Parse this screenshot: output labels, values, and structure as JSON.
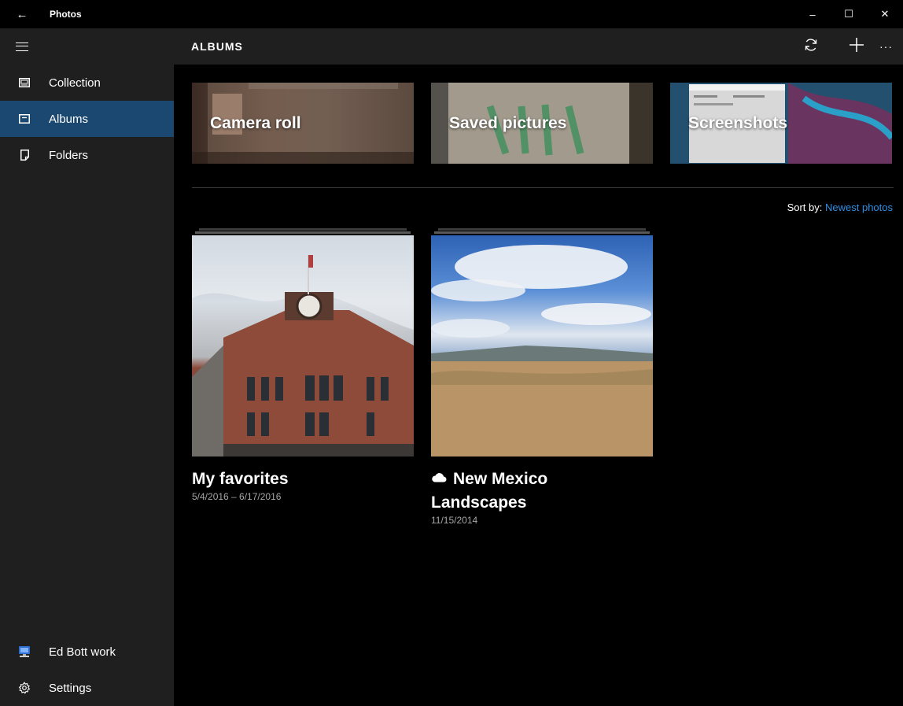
{
  "window": {
    "title": "Photos",
    "back_icon": "←",
    "minimize_icon": "–",
    "maximize_icon": "☐",
    "close_icon": "✕"
  },
  "sidebar": {
    "items": [
      {
        "label": "Collection",
        "icon": "collection-icon"
      },
      {
        "label": "Albums",
        "icon": "albums-icon",
        "active": true
      },
      {
        "label": "Folders",
        "icon": "folders-icon"
      }
    ],
    "bottom": [
      {
        "label": "Ed Bott work",
        "icon": "computer-account-icon"
      },
      {
        "label": "Settings",
        "icon": "gear-icon"
      }
    ]
  },
  "header": {
    "title": "ALBUMS",
    "more_label": "···"
  },
  "top_albums": [
    {
      "label": "Camera roll"
    },
    {
      "label": "Saved pictures"
    },
    {
      "label": "Screenshots"
    }
  ],
  "sort": {
    "prefix": "Sort by:",
    "value": "Newest photos"
  },
  "albums": [
    {
      "title": "My favorites",
      "date": "5/4/2016 – 6/17/2016"
    },
    {
      "title_line1": "New Mexico",
      "title_line2": "Landscapes",
      "date": "11/15/2014",
      "icon": "onedrive-cloud-icon"
    }
  ],
  "colors": {
    "sidebar_bg": "#1f1f1f",
    "active_item_bg": "#1b4870",
    "accent_link": "#2f8fe4"
  }
}
